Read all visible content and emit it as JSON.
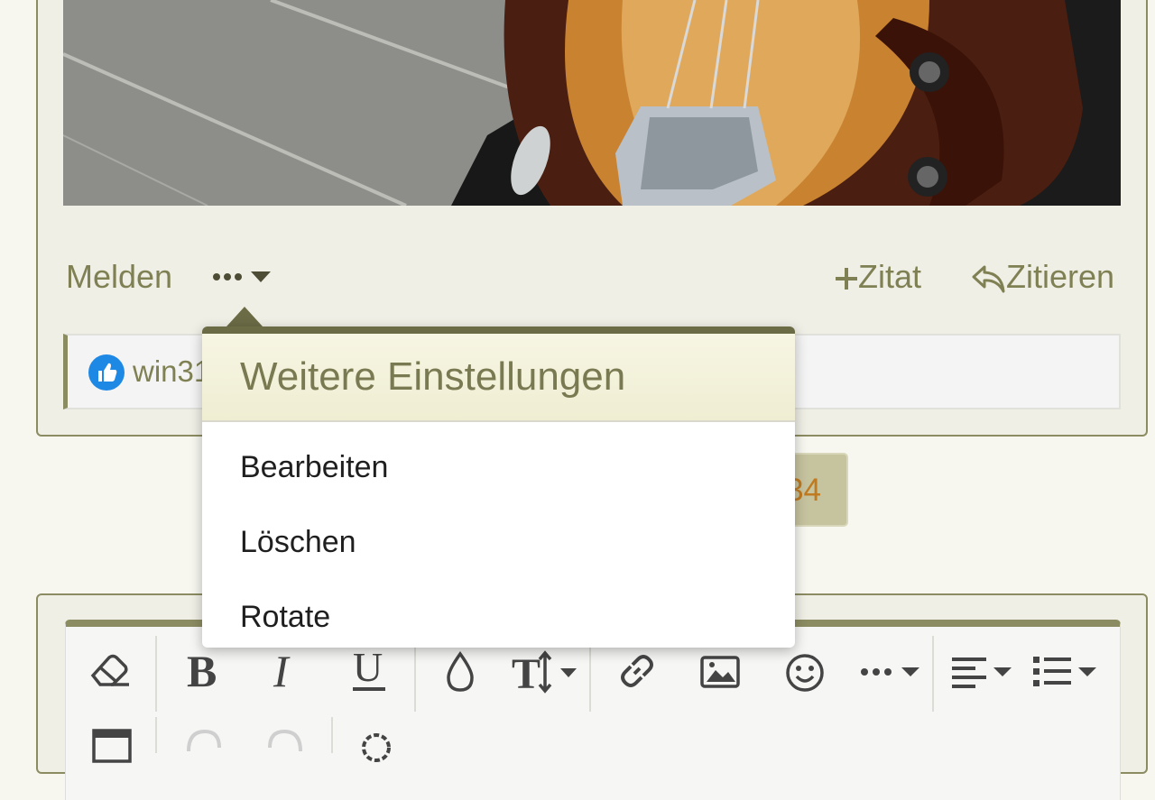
{
  "post": {
    "actions": {
      "report_label": "Melden",
      "more_label": "•••",
      "add_quote_label": "Zitat",
      "quote_label": "Zitieren"
    },
    "reactions": {
      "user": "win31"
    }
  },
  "pagination": {
    "visible_page_fragment": "34"
  },
  "dropdown": {
    "title": "Weitere Einstellungen",
    "items": [
      {
        "label": "Bearbeiten"
      },
      {
        "label": "Löschen"
      },
      {
        "label": "Rotate"
      }
    ]
  },
  "editor": {
    "toolbar": [
      "eraser-icon",
      "bold-icon",
      "italic-icon",
      "underline-icon",
      "color-drop-icon",
      "text-size-icon",
      "link-icon",
      "image-icon",
      "smiley-icon",
      "more-options-icon",
      "align-icon",
      "list-icon",
      "table-icon",
      "undo-icon",
      "redo-icon",
      "settings-icon"
    ]
  },
  "colors": {
    "accent": "#8c8c62",
    "accent_dark": "#6b6b46",
    "link_text": "#7f8053",
    "page_bg": "#f7f7f0",
    "like_blue": "#1e88e5"
  }
}
